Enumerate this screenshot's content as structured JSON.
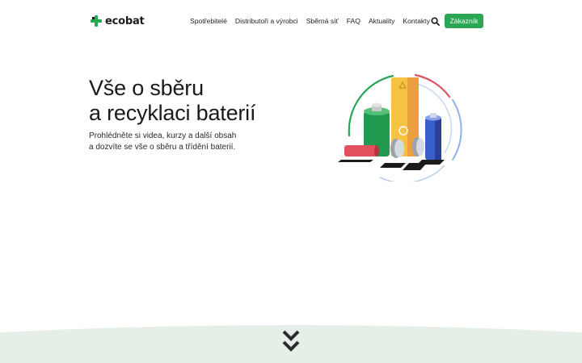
{
  "brand": {
    "name": "ecobat"
  },
  "nav": {
    "items": [
      "Spotřebitelé",
      "Distributoři a výrobci",
      "Sběrná síť",
      "FAQ",
      "Aktuality",
      "Kontakty"
    ],
    "cta_label": "Zákazník"
  },
  "hero": {
    "title_line1": "Vše o sběru",
    "title_line2": "a recyklaci baterií",
    "subtitle_line1": "Prohlédněte si videa, kurzy a další obsah",
    "subtitle_line2": "a dozvíte se vše o sběru a třídění baterií."
  },
  "colors": {
    "accent": "#2aa655",
    "band": "#e5efe7",
    "dark": "#2c2c2c"
  },
  "icons": [
    "logo-icon",
    "search-icon",
    "chevron-double-down-icon",
    "battery-illustration"
  ]
}
